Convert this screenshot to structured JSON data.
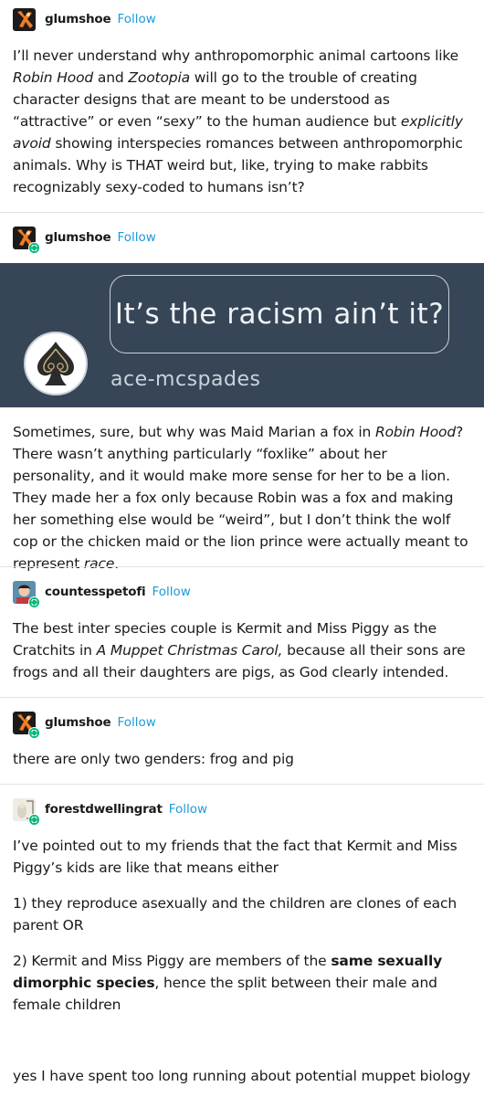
{
  "follow_label": "Follow",
  "posts": [
    {
      "username": "glumshoe",
      "paragraphs": [
        [
          "I’ll never understand why anthropomorphic animal cartoons like ",
          {
            "i": "Robin Hood"
          },
          " and ",
          {
            "i": "Zootopia"
          },
          " will go to the trouble of creating character designs that are meant to be understood as “attractive” or even “sexy” to the human audience but ",
          {
            "i": "explicitly avoid"
          },
          " showing interspecies romances between anthropomorphic animals. Why is THAT weird but, like, trying to make rabbits recognizably sexy-coded to humans isn’t?"
        ]
      ]
    },
    {
      "username": "glumshoe",
      "image": {
        "quote": "It’s the racism ain’t it?",
        "author": "ace-mcspades"
      },
      "paragraphs": [
        [
          "Sometimes, sure, but why was Maid Marian a fox in ",
          {
            "i": "Robin Hood"
          },
          "? There wasn’t anything particularly “foxlike” about her personality, and it would make more sense for her to be a lion. They made her a fox only because Robin was a fox and making her something else would be “weird”, but I don’t think the wolf cop or the chicken maid or the lion prince were actually meant to represent ",
          {
            "i": "race"
          },
          "."
        ]
      ]
    },
    {
      "username": "countesspetofi",
      "paragraphs": [
        [
          "The best inter species couple is Kermit and Miss Piggy as the Cratchits in ",
          {
            "i": "A Muppet Christmas Carol,"
          },
          " because all their sons are frogs and all their daughters are pigs, as God clearly intended."
        ]
      ]
    },
    {
      "username": "glumshoe",
      "paragraphs": [
        [
          "there are only two genders: frog and pig"
        ]
      ]
    },
    {
      "username": "forestdwellingrat",
      "paragraphs": [
        [
          "I’ve pointed out to my friends that the fact that Kermit and Miss Piggy’s kids are like that means either"
        ],
        [
          "1) they reproduce asexually and the children are clones of each parent OR"
        ],
        [
          "2) Kermit and Miss Piggy are members of the ",
          {
            "b": "same sexually dimorphic species"
          },
          ", hence the split between their male and female children"
        ],
        [
          "yes I have spent too long running about potential muppet biology"
        ]
      ]
    }
  ],
  "colors": {
    "follow": "#1d9bd8",
    "reblog_badge": "#00b87a",
    "banner_bg": "#374657",
    "separator": "#e2e2e2"
  }
}
